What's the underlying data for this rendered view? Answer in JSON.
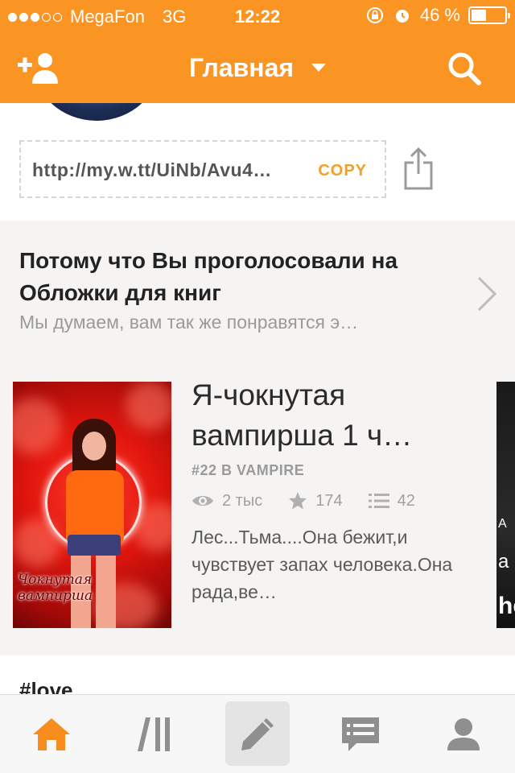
{
  "status_bar": {
    "carrier": "MegaFon",
    "network": "3G",
    "time": "12:22",
    "battery": "46 %",
    "battery_level": 0.46
  },
  "header": {
    "title": "Главная"
  },
  "share": {
    "url": "http://my.w.tt/UiNb/Avu4…",
    "copy_label": "COPY"
  },
  "recommendation": {
    "heading": "Потому что Вы проголосовали на Обложки для книг",
    "subtitle": "Мы думаем, вам так же понравятся э…",
    "book": {
      "title": "Я-чокнутая вампирша   1 ч…",
      "rank": "#22 В VAMPIRE",
      "views": "2 тыс",
      "votes": "174",
      "parts": "42",
      "description": "Лес...Тьма....Она бежит,и чувствует запах человека.Она рада,ве…",
      "cover_script": "Чокнутая вампирша"
    },
    "peek_text": {
      "t1": "A",
      "t2": "a",
      "t3": "he"
    }
  },
  "next_section": {
    "heading": "#love"
  },
  "colors": {
    "brand": "#fa9524",
    "copy": "#f3a027",
    "tab_active": "#f68d1e",
    "tab_inactive": "#8f8f8f"
  },
  "tabs": [
    {
      "icon": "home-icon",
      "active": true
    },
    {
      "icon": "library-icon",
      "active": false
    },
    {
      "icon": "write-icon",
      "active": false
    },
    {
      "icon": "messages-icon",
      "active": false
    },
    {
      "icon": "profile-icon",
      "active": false
    }
  ]
}
